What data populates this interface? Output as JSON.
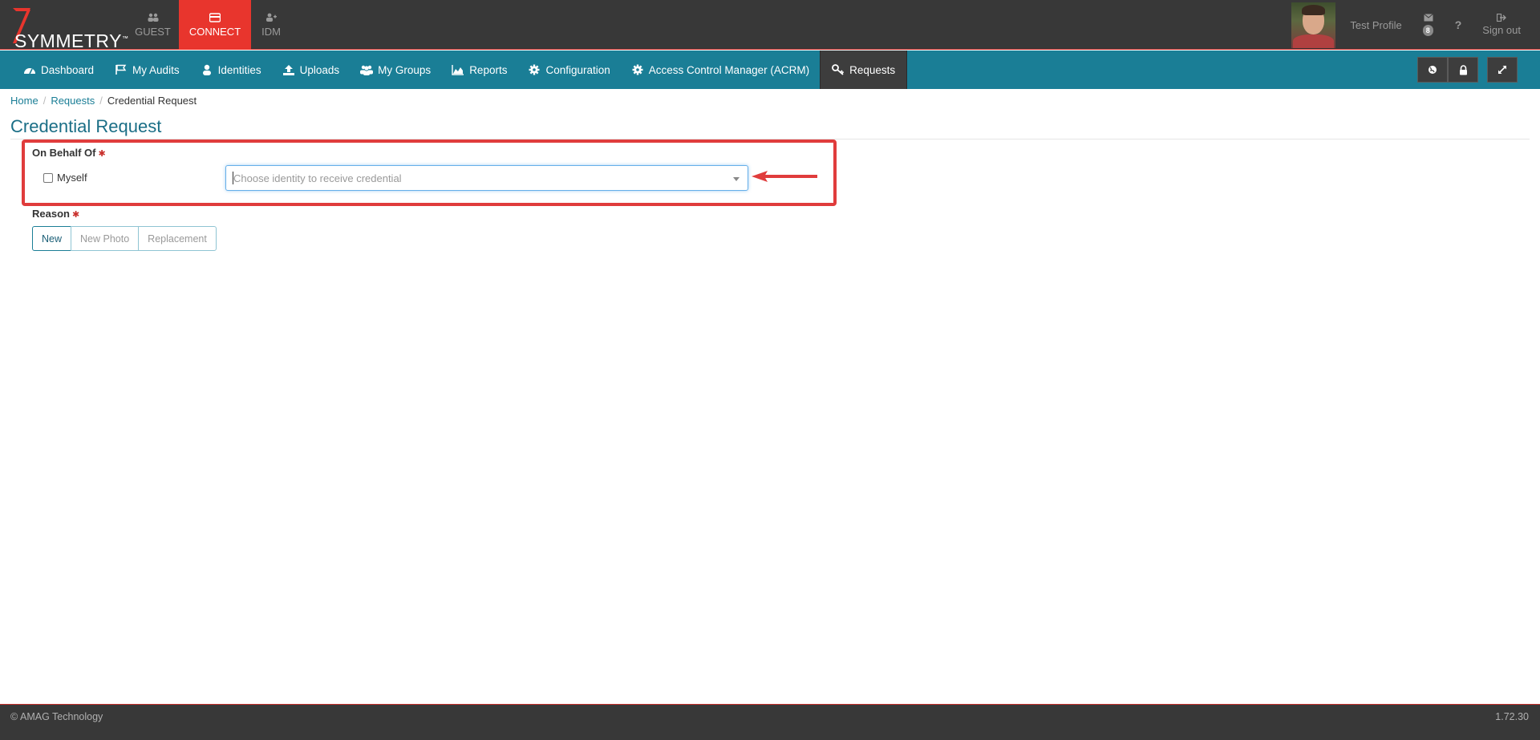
{
  "header": {
    "logo_text": "SYMMETRY",
    "logo_tm": "™",
    "apps": [
      {
        "label": "GUEST",
        "icon": "users-icon"
      },
      {
        "label": "CONNECT",
        "icon": "card-icon",
        "active": true
      },
      {
        "label": "IDM",
        "icon": "user-plus-icon"
      }
    ],
    "profile_name": "Test Profile",
    "mail_count": "8",
    "help_label": "?",
    "signout_label": "Sign out"
  },
  "nav": {
    "items": [
      {
        "label": "Dashboard",
        "icon": "dashboard-icon"
      },
      {
        "label": "My Audits",
        "icon": "flag-icon"
      },
      {
        "label": "Identities",
        "icon": "user-icon"
      },
      {
        "label": "Uploads",
        "icon": "upload-icon"
      },
      {
        "label": "My Groups",
        "icon": "group-icon"
      },
      {
        "label": "Reports",
        "icon": "area-chart-icon"
      },
      {
        "label": "Configuration",
        "icon": "gear-icon"
      },
      {
        "label": "Access Control Manager (ACRM)",
        "icon": "gear-icon"
      },
      {
        "label": "Requests",
        "icon": "key-icon",
        "active": true
      }
    ],
    "right_buttons": [
      "globe-icon",
      "lock-icon",
      "expand-icon"
    ]
  },
  "breadcrumb": {
    "home": "Home",
    "requests": "Requests",
    "current": "Credential Request",
    "separator": "/"
  },
  "page": {
    "title": "Credential Request",
    "on_behalf_label": "On Behalf Of",
    "required_mark": "✱",
    "myself_label": "Myself",
    "identity_placeholder": "Choose identity to receive credential",
    "reason_label": "Reason",
    "reason_options": [
      "New",
      "New Photo",
      "Replacement"
    ],
    "reason_selected": "New"
  },
  "footer": {
    "copyright": "© AMAG Technology",
    "version": "1.72.30"
  },
  "colors": {
    "brand_red": "#e8352d",
    "nav_teal": "#1a7e96",
    "dark": "#383838",
    "highlight": "#e03c3c"
  }
}
